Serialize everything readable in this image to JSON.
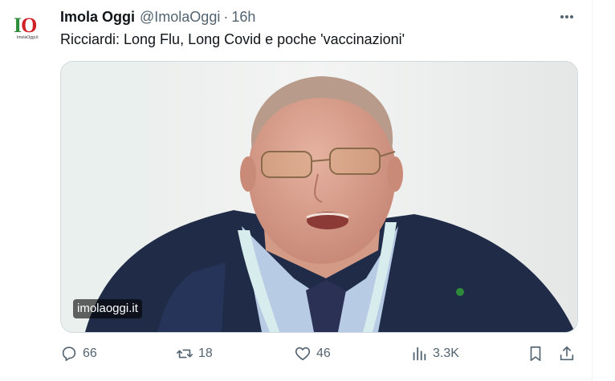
{
  "tweet": {
    "author_name": "Imola Oggi",
    "handle": "@ImolaOggi",
    "separator": "·",
    "time": "16h",
    "text": "Ricciardi: Long Flu, Long Covid e poche 'vaccinazioni'",
    "avatar": {
      "logo_text_i": "I",
      "logo_text_o": "O",
      "logo_sub": "ImolaOggi.it"
    },
    "media": {
      "source_tag": "imolaoggi.it",
      "alt": "Man with glasses in a dark suit speaking, wearing a lanyard"
    },
    "more_icon": "more-horizontal-icon"
  },
  "actions": {
    "replies": {
      "icon": "reply-icon",
      "count": "66"
    },
    "reposts": {
      "icon": "repost-icon",
      "count": "18"
    },
    "likes": {
      "icon": "like-icon",
      "count": "46"
    },
    "views": {
      "icon": "views-icon",
      "count": "3.3K"
    },
    "bookmark": {
      "icon": "bookmark-icon"
    },
    "share": {
      "icon": "share-icon"
    }
  },
  "colors": {
    "text": "#0f1419",
    "secondary": "#536471",
    "border": "#cfd9de",
    "logo_green": "#2e8b3a",
    "logo_red": "#d11f26"
  }
}
